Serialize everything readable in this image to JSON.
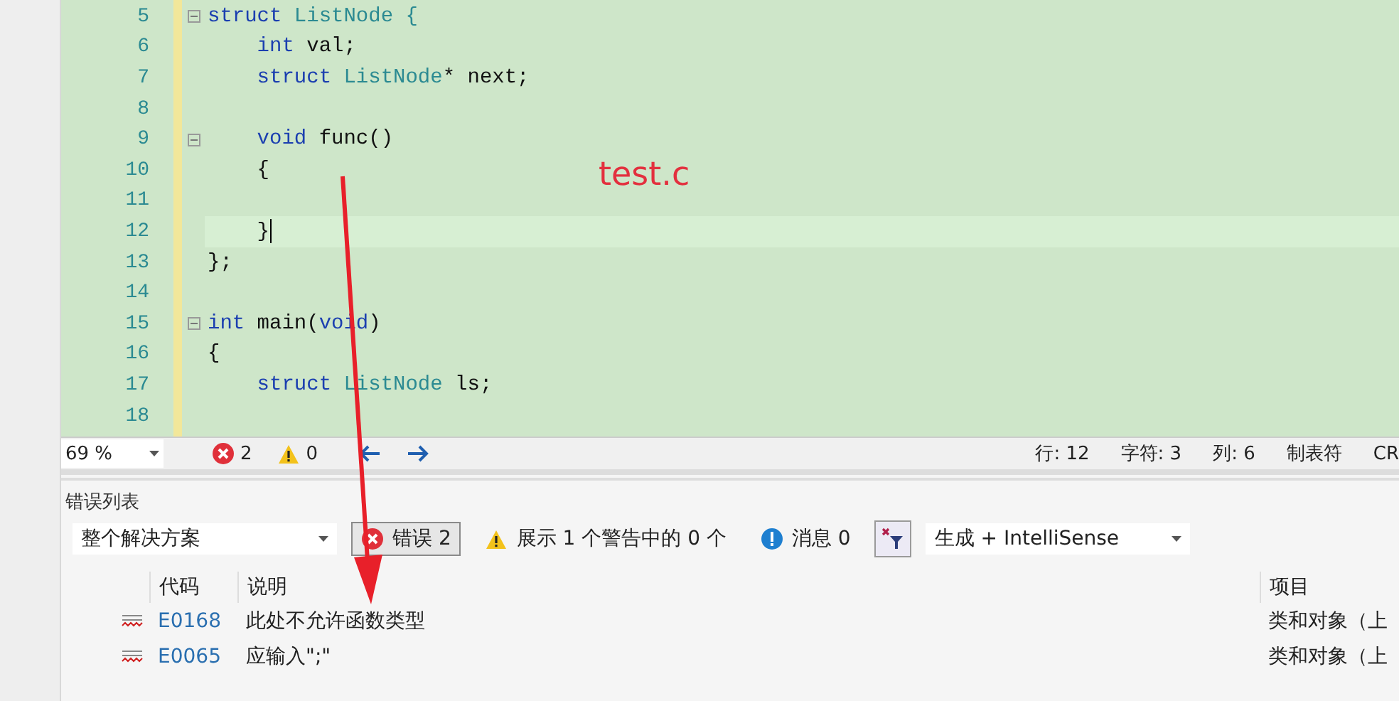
{
  "editor": {
    "lines": [
      {
        "number": "5",
        "fold": true,
        "current": false,
        "tokens": [
          {
            "text": "struct",
            "kind": "keyword"
          },
          {
            "text": " ListNode {",
            "kind": "type"
          }
        ]
      },
      {
        "number": "6",
        "fold": false,
        "current": false,
        "tokens": [
          {
            "text": "    int",
            "kind": "keyword"
          },
          {
            "text": " val;",
            "kind": "plain"
          }
        ]
      },
      {
        "number": "7",
        "fold": false,
        "current": false,
        "tokens": [
          {
            "text": "    struct",
            "kind": "keyword"
          },
          {
            "text": " ListNode",
            "kind": "type"
          },
          {
            "text": "* next;",
            "kind": "plain"
          }
        ]
      },
      {
        "number": "8",
        "fold": false,
        "current": false
      },
      {
        "number": "9",
        "fold": true,
        "current": false,
        "tokens": [
          {
            "text": "    void",
            "kind": "keyword"
          },
          {
            "text": " func()",
            "kind": "plain"
          }
        ]
      },
      {
        "number": "10",
        "fold": false,
        "current": false,
        "tokens": [
          {
            "text": "    {",
            "kind": "plain"
          }
        ]
      },
      {
        "number": "11",
        "fold": false,
        "current": false
      },
      {
        "number": "12",
        "fold": false,
        "current": true,
        "tokens": [
          {
            "text": "    }",
            "kind": "plain"
          }
        ]
      },
      {
        "number": "13",
        "fold": false,
        "current": false,
        "tokens": [
          {
            "text": "};",
            "kind": "plain"
          }
        ]
      },
      {
        "number": "14",
        "fold": false,
        "current": false
      },
      {
        "number": "15",
        "fold": true,
        "current": false,
        "tokens": [
          {
            "text": "int",
            "kind": "keyword"
          },
          {
            "text": " main(",
            "kind": "plain"
          },
          {
            "text": "void",
            "kind": "keyword"
          },
          {
            "text": ")",
            "kind": "plain"
          }
        ]
      },
      {
        "number": "16",
        "fold": false,
        "current": false,
        "tokens": [
          {
            "text": "{",
            "kind": "plain"
          }
        ]
      },
      {
        "number": "17",
        "fold": false,
        "current": false,
        "tokens": [
          {
            "text": "    struct",
            "kind": "keyword"
          },
          {
            "text": " ListNode",
            "kind": "type"
          },
          {
            "text": " ls;",
            "kind": "plain"
          }
        ]
      },
      {
        "number": "18",
        "fold": false,
        "current": false
      }
    ],
    "annotation": "test.c"
  },
  "status_bar": {
    "zoom": "69 %",
    "errors": "2",
    "warnings": "0",
    "line": "行: 12",
    "char": "字符: 3",
    "col": "列: 6",
    "indent": "制表符",
    "eol": "CR"
  },
  "error_list": {
    "title": "错误列表",
    "scope": "整个解决方案",
    "errors_filter": {
      "label": "错误 2",
      "selected": true
    },
    "warnings_filter": {
      "label": "展示 1 个警告中的 0 个",
      "selected": false
    },
    "messages_filter": {
      "label": "消息 0",
      "selected": false
    },
    "source": "生成 + IntelliSense",
    "columns": [
      "代码",
      "说明",
      "项目"
    ],
    "rows": [
      {
        "code": "E0168",
        "description": "此处不允许函数类型",
        "project": "类和对象（上"
      },
      {
        "code": "E0065",
        "description": "应输入\";\"",
        "project": "类和对象（上"
      }
    ]
  }
}
